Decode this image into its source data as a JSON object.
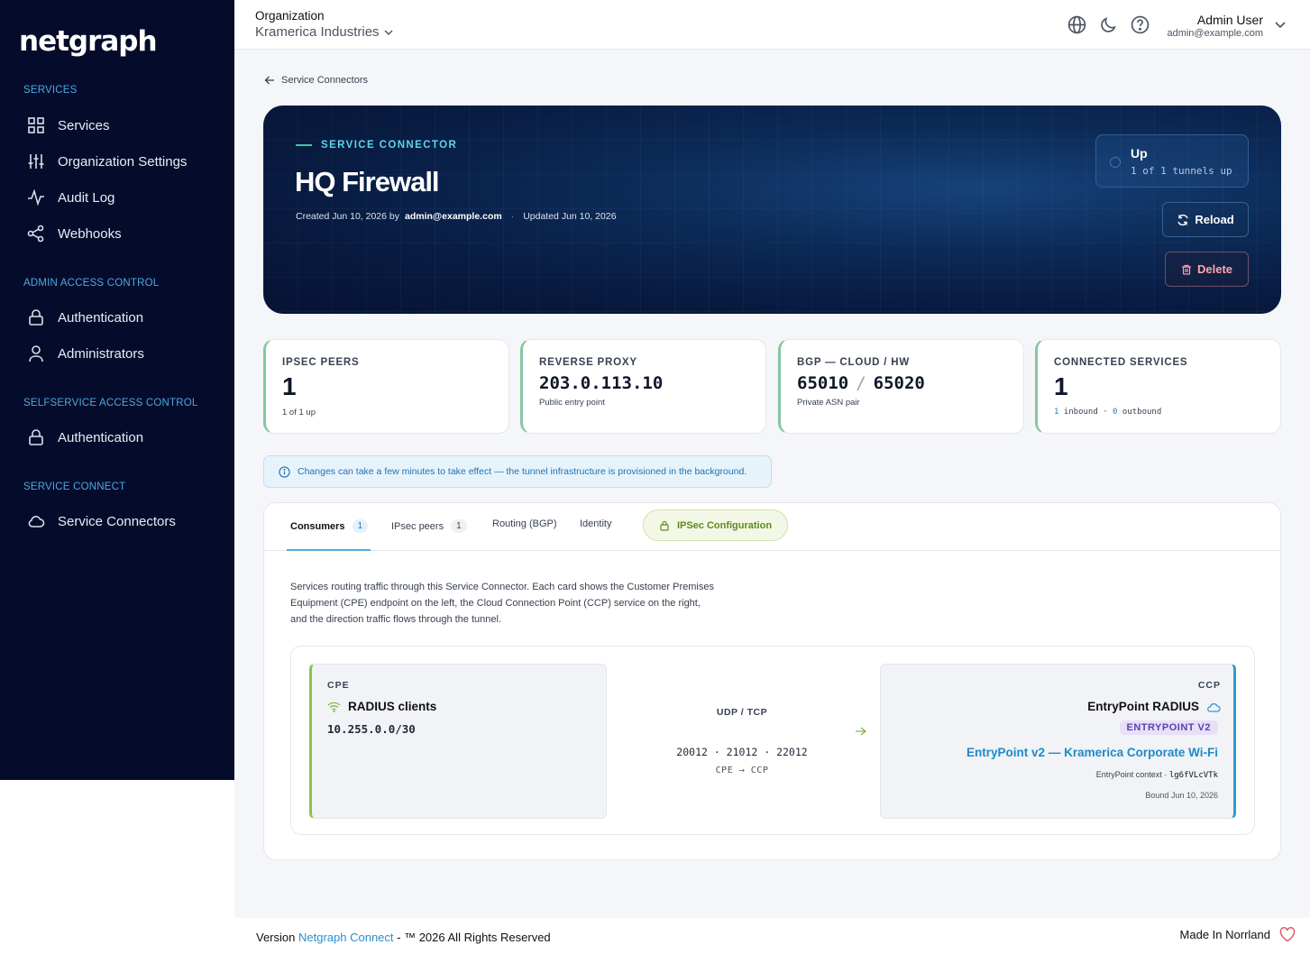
{
  "brand": {
    "logo": "netgraph"
  },
  "sidebar": {
    "sections": [
      {
        "title": "SERVICES",
        "items": [
          {
            "label": "Services",
            "icon": "grid-icon"
          },
          {
            "label": "Organization Settings",
            "icon": "sliders-icon"
          },
          {
            "label": "Audit Log",
            "icon": "activity-icon"
          },
          {
            "label": "Webhooks",
            "icon": "share-icon"
          }
        ]
      },
      {
        "title": "ADMIN ACCESS CONTROL",
        "items": [
          {
            "label": "Authentication",
            "icon": "lock-icon"
          },
          {
            "label": "Administrators",
            "icon": "user-icon"
          }
        ]
      },
      {
        "title": "SELFSERVICE ACCESS CONTROL",
        "items": [
          {
            "label": "Authentication",
            "icon": "lock-icon"
          }
        ]
      },
      {
        "title": "SERVICE CONNECT",
        "items": [
          {
            "label": "Service Connectors",
            "icon": "cloud-icon"
          }
        ]
      }
    ]
  },
  "topbar": {
    "org_label": "Organization",
    "org_name": "Kramerica Industries",
    "user_name": "Admin User",
    "user_email": "admin@example.com"
  },
  "breadcrumb": {
    "back_label": "Service Connectors"
  },
  "hero": {
    "kicker": "SERVICE CONNECTOR",
    "title": "HQ Firewall",
    "created_prefix": "Created Jun 10, 2026 by",
    "created_by": "admin@example.com",
    "updated": "Updated Jun 10, 2026",
    "status": "Up",
    "status_sub": "1 of 1 tunnels up",
    "reload_label": "Reload",
    "delete_label": "Delete"
  },
  "stats": {
    "ipsec": {
      "label": "IPSEC PEERS",
      "value": "1",
      "sub": "1 of 1 up"
    },
    "proxy": {
      "label": "REVERSE PROXY",
      "value": "203.0.113.10",
      "sub": "Public entry point"
    },
    "bgp": {
      "label": "BGP — CLOUD / HW",
      "cloud": "65010",
      "separator": "/",
      "hw": "65020",
      "sub": "Private ASN pair"
    },
    "connected": {
      "label": "CONNECTED SERVICES",
      "value": "1",
      "inbound": "1",
      "inbound_label": "inbound",
      "sep": "·",
      "outbound": "0",
      "outbound_label": "outbound"
    }
  },
  "info": {
    "text": "Changes can take a few minutes to take effect — the tunnel infrastructure is provisioned in the background."
  },
  "tabs": {
    "consumers": {
      "label": "Consumers",
      "count": "1"
    },
    "ipsec_peers": {
      "label": "IPsec peers",
      "count": "1"
    },
    "routing": {
      "label": "Routing (BGP)"
    },
    "identity": {
      "label": "Identity"
    },
    "ipsec_config": {
      "label": "IPSec Configuration"
    }
  },
  "consumers": {
    "description": "Services routing traffic through this Service Connector. Each card shows the Customer Premises Equipment (CPE) endpoint on the left, the Cloud Connection Point (CCP) service on the right, and the direction traffic flows through the tunnel.",
    "cpe": {
      "kicker": "CPE",
      "name": "RADIUS clients",
      "cidr": "10.255.0.0/30"
    },
    "protocol": "UDP / TCP",
    "ports": "20012 · 21012 · 22012",
    "direction": "CPE → CCP",
    "ccp": {
      "kicker": "CCP",
      "name": "EntryPoint RADIUS",
      "badge": "ENTRYPOINT V2",
      "link": "EntryPoint v2 — Kramerica Corporate Wi-Fi",
      "context_label": "EntryPoint context ·",
      "context_id": "lg6fVLcVTk",
      "bound": "Bound Jun 10, 2026"
    }
  },
  "footer": {
    "version_prefix": "Version",
    "version_link": "Netgraph Connect",
    "rights": "- ™ 2026 All Rights Reserved",
    "made_in": "Made In Norrland"
  },
  "colors": {
    "sidebar_bg": "#050c2b",
    "accent_blue": "#2b8ed0",
    "accent_green": "#8bc34a",
    "danger": "#fca5a5"
  }
}
